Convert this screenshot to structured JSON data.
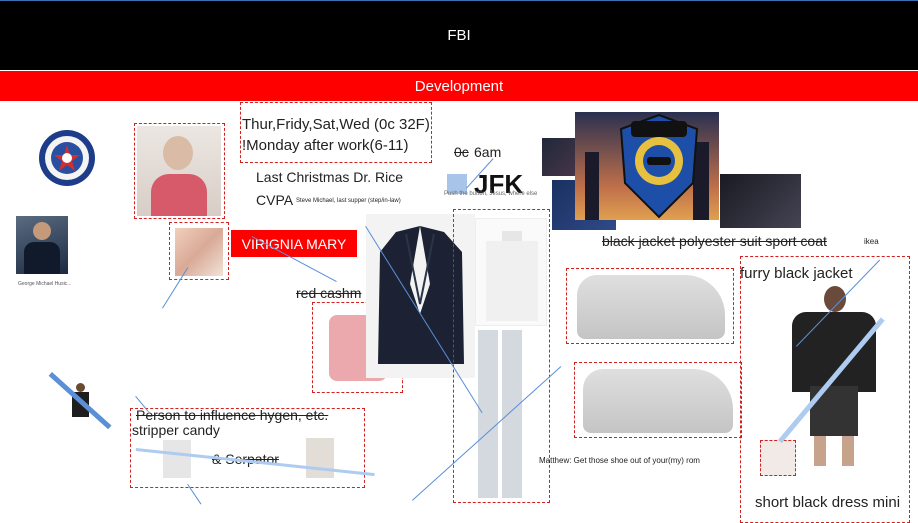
{
  "header": {
    "title": "FBI",
    "subtitle": "Development"
  },
  "notes": {
    "days": "Thur,Fridy,Sat,Wed (0c 32F)",
    "monday": "!Monday after work(6-11)",
    "time_strike": "0c",
    "time": "6am",
    "jfk": "JFK",
    "jfk_small": "Push the button, Jesus, where else",
    "christmas": "Last Christmas Dr. Rice",
    "cvpa": "CVPA",
    "cvpa_small": "Steve Michael, last supper (step/in-law)",
    "virginia": "VIRIGNIA MARY",
    "red_cashmere": "red cashm",
    "black_jacket": "black jacket polyester suit sport coat",
    "ikea": "ikea",
    "furry": "furry black jacket",
    "person": "Person to influence hygen, etc.",
    "stripper": "stripper candy",
    "serpator": "& Serpator",
    "matthew": "Matthew: Get those shoe out of your(my) rom",
    "short_dress": "short black dress mini",
    "photo_caption": "George Michael Husic..."
  },
  "colors": {
    "header_bg": "#000000",
    "banner_bg": "#ff0000",
    "label_bg": "#ff0000",
    "dash": "#d02020",
    "line": "#5b8fd6"
  },
  "icons": [
    "cia-seal-icon",
    "disco-police-badge-icon"
  ]
}
